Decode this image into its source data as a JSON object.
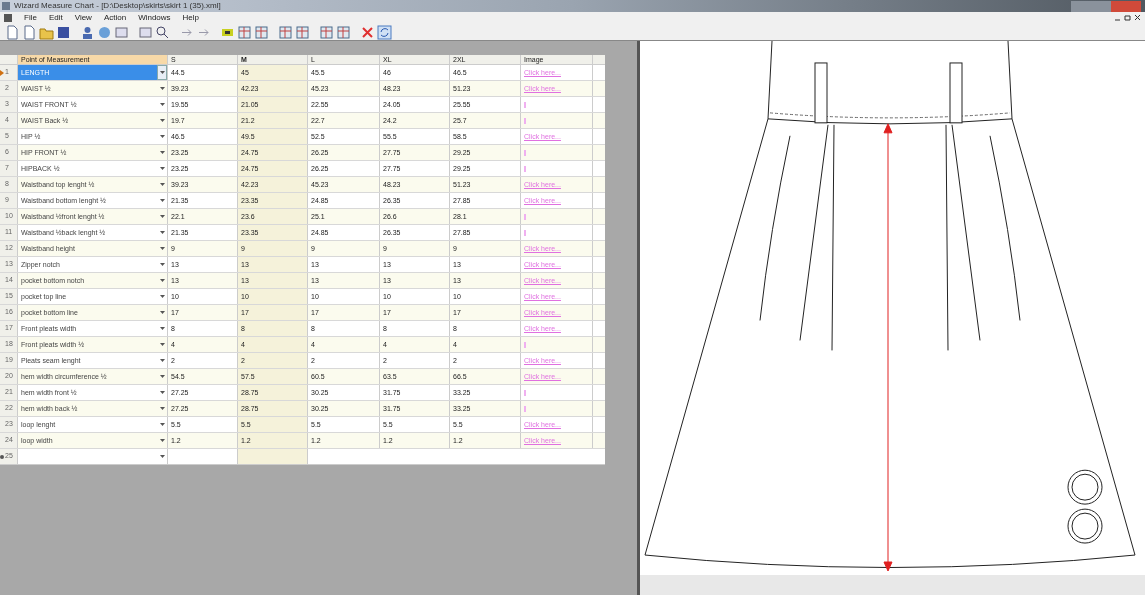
{
  "window": {
    "title": "Wizard Measure Chart - [D:\\Desktop\\skirts\\skirt 1 (35).xml]"
  },
  "menu": [
    "File",
    "Edit",
    "View",
    "Action",
    "Windows",
    "Help"
  ],
  "table": {
    "columns": [
      "Point of Measurement",
      "S",
      "M",
      "L",
      "XL",
      "2XL",
      "Image"
    ],
    "rows": [
      {
        "number": "1",
        "point": "LENGTH",
        "values": [
          "44.5",
          "45",
          "45.5",
          "46",
          "46.5"
        ],
        "image": {
          "kind": "link",
          "text": "Click here..."
        },
        "selected": true
      },
      {
        "number": "2",
        "point": "WAIST ½",
        "values": [
          "39.23",
          "42.23",
          "45.23",
          "48.23",
          "51.23"
        ],
        "image": {
          "kind": "link",
          "text": "Click here..."
        },
        "selected": false
      },
      {
        "number": "3",
        "point": "WAIST FRONT ½",
        "values": [
          "19.55",
          "21.05",
          "22.55",
          "24.05",
          "25.55"
        ],
        "image": {
          "kind": "empty"
        },
        "selected": false
      },
      {
        "number": "4",
        "point": "WAIST Back ½",
        "values": [
          "19.7",
          "21.2",
          "22.7",
          "24.2",
          "25.7"
        ],
        "image": {
          "kind": "empty"
        },
        "selected": false
      },
      {
        "number": "5",
        "point": "HIP ½",
        "values": [
          "46.5",
          "49.5",
          "52.5",
          "55.5",
          "58.5"
        ],
        "image": {
          "kind": "link",
          "text": "Click here..."
        },
        "selected": false
      },
      {
        "number": "6",
        "point": "HIP FRONT ½",
        "values": [
          "23.25",
          "24.75",
          "26.25",
          "27.75",
          "29.25"
        ],
        "image": {
          "kind": "empty"
        },
        "selected": false
      },
      {
        "number": "7",
        "point": "HIPBACK ½",
        "values": [
          "23.25",
          "24.75",
          "26.25",
          "27.75",
          "29.25"
        ],
        "image": {
          "kind": "empty"
        },
        "selected": false
      },
      {
        "number": "8",
        "point": "Waistband top lenght ½",
        "values": [
          "39.23",
          "42.23",
          "45.23",
          "48.23",
          "51.23"
        ],
        "image": {
          "kind": "link",
          "text": "Click here..."
        },
        "selected": false
      },
      {
        "number": "9",
        "point": "Waistband bottom lenght ½",
        "values": [
          "21.35",
          "23.35",
          "24.85",
          "26.35",
          "27.85"
        ],
        "image": {
          "kind": "link",
          "text": "Click here..."
        },
        "selected": false
      },
      {
        "number": "10",
        "point": "Waistband ½front lenght ½",
        "values": [
          "22.1",
          "23.6",
          "25.1",
          "26.6",
          "28.1"
        ],
        "image": {
          "kind": "empty"
        },
        "selected": false
      },
      {
        "number": "11",
        "point": "Waistband ½back lenght ½",
        "values": [
          "21.35",
          "23.35",
          "24.85",
          "26.35",
          "27.85"
        ],
        "image": {
          "kind": "empty"
        },
        "selected": false
      },
      {
        "number": "12",
        "point": "Waistband height",
        "values": [
          "9",
          "9",
          "9",
          "9",
          "9"
        ],
        "image": {
          "kind": "link",
          "text": "Click here..."
        },
        "selected": false
      },
      {
        "number": "13",
        "point": "Zipper notch",
        "values": [
          "13",
          "13",
          "13",
          "13",
          "13"
        ],
        "image": {
          "kind": "link",
          "text": "Click here..."
        },
        "selected": false
      },
      {
        "number": "14",
        "point": "pocket bottom notch",
        "values": [
          "13",
          "13",
          "13",
          "13",
          "13"
        ],
        "image": {
          "kind": "link",
          "text": "Click here..."
        },
        "selected": false
      },
      {
        "number": "15",
        "point": "pocket top line",
        "values": [
          "10",
          "10",
          "10",
          "10",
          "10"
        ],
        "image": {
          "kind": "link",
          "text": "Click here..."
        },
        "selected": false
      },
      {
        "number": "16",
        "point": "pocket bottom line",
        "values": [
          "17",
          "17",
          "17",
          "17",
          "17"
        ],
        "image": {
          "kind": "link",
          "text": "Click here..."
        },
        "selected": false
      },
      {
        "number": "17",
        "point": "Front pleats width",
        "values": [
          "8",
          "8",
          "8",
          "8",
          "8"
        ],
        "image": {
          "kind": "link",
          "text": "Click here..."
        },
        "selected": false
      },
      {
        "number": "18",
        "point": "Front pleats width ½",
        "values": [
          "4",
          "4",
          "4",
          "4",
          "4"
        ],
        "image": {
          "kind": "empty"
        },
        "selected": false
      },
      {
        "number": "19",
        "point": "Pleats seam lenght",
        "values": [
          "2",
          "2",
          "2",
          "2",
          "2"
        ],
        "image": {
          "kind": "link",
          "text": "Click here..."
        },
        "selected": false
      },
      {
        "number": "20",
        "point": "hem width circumference ½",
        "values": [
          "54.5",
          "57.5",
          "60.5",
          "63.5",
          "66.5"
        ],
        "image": {
          "kind": "link",
          "text": "Click here..."
        },
        "selected": false
      },
      {
        "number": "21",
        "point": "hem width front ½",
        "values": [
          "27.25",
          "28.75",
          "30.25",
          "31.75",
          "33.25"
        ],
        "image": {
          "kind": "empty"
        },
        "selected": false
      },
      {
        "number": "22",
        "point": "hem width back ½",
        "values": [
          "27.25",
          "28.75",
          "30.25",
          "31.75",
          "33.25"
        ],
        "image": {
          "kind": "empty"
        },
        "selected": false
      },
      {
        "number": "23",
        "point": "loop lenght",
        "values": [
          "5.5",
          "5.5",
          "5.5",
          "5.5",
          "5.5"
        ],
        "image": {
          "kind": "link",
          "text": "Click here..."
        },
        "selected": false
      },
      {
        "number": "24",
        "point": "loop width",
        "values": [
          "1.2",
          "1.2",
          "1.2",
          "1.2",
          "1.2"
        ],
        "image": {
          "kind": "link",
          "text": "Click here..."
        },
        "selected": false
      }
    ],
    "new_row": {
      "number": "25"
    }
  }
}
